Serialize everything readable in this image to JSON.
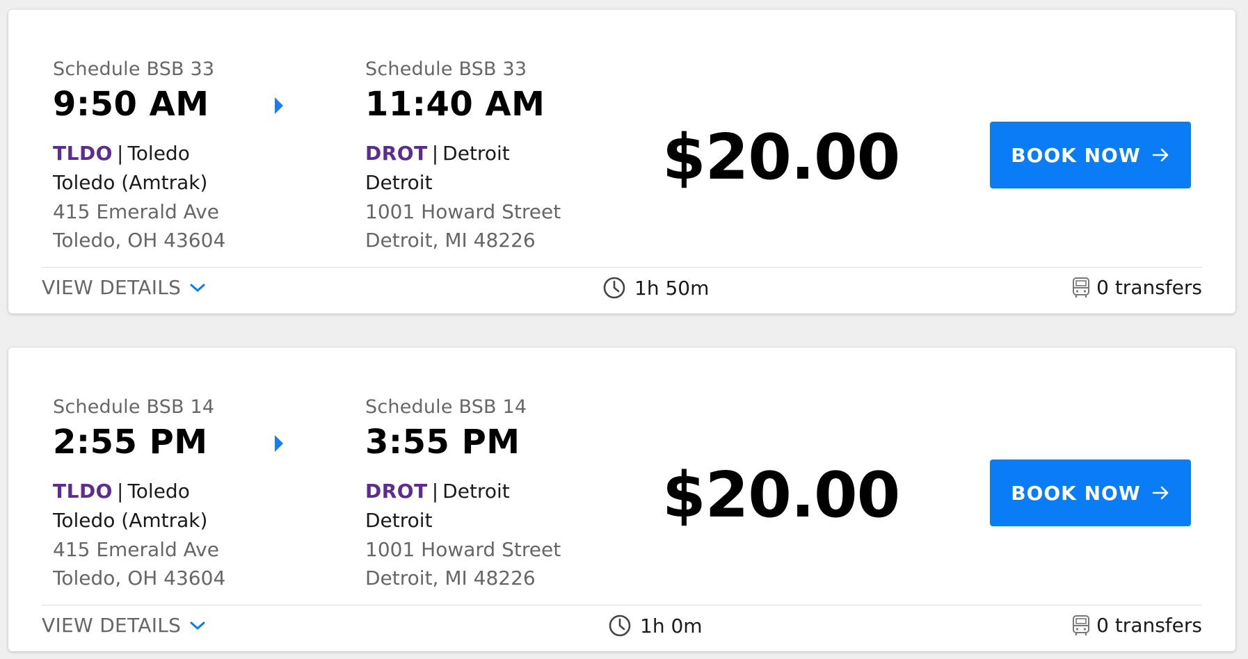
{
  "trips": [
    {
      "origin": {
        "schedule": "Schedule BSB 33",
        "time": "9:50 AM",
        "code": "TLDO",
        "city": "Toledo",
        "station": "Toledo (Amtrak)",
        "address_line1": "415 Emerald Ave",
        "address_line2": "Toledo, OH 43604"
      },
      "destination": {
        "schedule": "Schedule BSB 33",
        "time": "11:40 AM",
        "code": "DROT",
        "city": "Detroit",
        "station": "Detroit",
        "address_line1": "1001 Howard Street",
        "address_line2": "Detroit, MI 48226"
      },
      "separator": "|",
      "price": "$20.00",
      "book_label": "BOOK NOW",
      "view_details_label": "VIEW DETAILS",
      "duration": "1h 50m",
      "transfers": "0 transfers"
    },
    {
      "origin": {
        "schedule": "Schedule BSB 14",
        "time": "2:55 PM",
        "code": "TLDO",
        "city": "Toledo",
        "station": "Toledo (Amtrak)",
        "address_line1": "415 Emerald Ave",
        "address_line2": "Toledo, OH 43604"
      },
      "destination": {
        "schedule": "Schedule BSB 14",
        "time": "3:55 PM",
        "code": "DROT",
        "city": "Detroit",
        "station": "Detroit",
        "address_line1": "1001 Howard Street",
        "address_line2": "Detroit, MI 48226"
      },
      "separator": "|",
      "price": "$20.00",
      "book_label": "BOOK NOW",
      "view_details_label": "VIEW DETAILS",
      "duration": "1h 0m",
      "transfers": "0 transfers"
    }
  ],
  "icons": {
    "direction": "caret-right-icon",
    "book": "arrow-right-icon",
    "details": "chevron-down-icon",
    "duration": "clock-icon",
    "transfers": "bus-icon"
  },
  "colors": {
    "accent": "#0a7cf5",
    "station_code": "#5b2d8e",
    "muted_text": "#666666",
    "background": "#efefef"
  }
}
